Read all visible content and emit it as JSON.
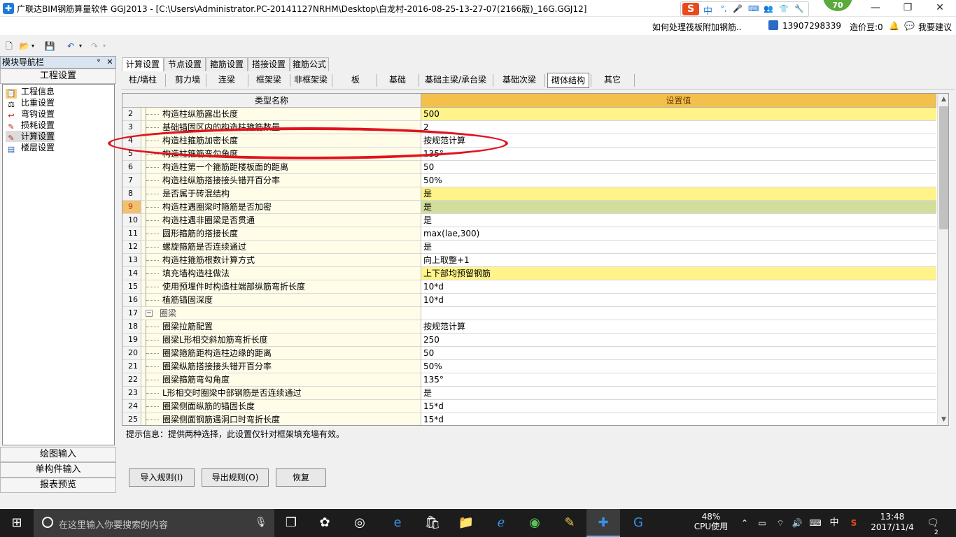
{
  "window": {
    "title": "广联达BIM钢筋算量软件 GGJ2013 - [C:\\Users\\Administrator.PC-20141127NRHM\\Desktop\\白龙村-2016-08-25-13-27-07(2166版)_16G.GGJ12]",
    "minimize": "—",
    "maximize": "❐",
    "close": "✕"
  },
  "ime": {
    "logo": "S",
    "lang": "中",
    "icons": [
      "•,",
      "🎙",
      "⌨",
      "👥",
      "👕",
      "🔧"
    ]
  },
  "score_badge": "70",
  "infobar": {
    "question": "如何处理筏板附加钢筋..",
    "phone": "13907298339",
    "beans": "造价豆:0",
    "suggest": "我要建议"
  },
  "toolbar": {
    "icons": [
      "new-file-icon",
      "open-folder-icon",
      "save-icon",
      "undo-icon",
      "redo-icon"
    ]
  },
  "nav": {
    "title": "模块导航栏",
    "pin": "ᵠ",
    "close": "✕",
    "section": "工程设置",
    "items": [
      {
        "label": "工程信息",
        "icon": "📋"
      },
      {
        "label": "比重设置",
        "icon": "⚖"
      },
      {
        "label": "弯钩设置",
        "icon": "↩"
      },
      {
        "label": "损耗设置",
        "icon": "📉"
      },
      {
        "label": "计算设置",
        "icon": "📝"
      },
      {
        "label": "楼层设置",
        "icon": "🏢"
      }
    ],
    "bottom_sections": [
      "绘图输入",
      "单构件输入",
      "报表预览"
    ]
  },
  "tabs_top": [
    "计算设置",
    "节点设置",
    "箍筋设置",
    "搭接设置",
    "箍筋公式"
  ],
  "tabs_sub": [
    "柱/墙柱",
    "剪力墙",
    "连梁",
    "框架梁",
    "非框架梁",
    "板",
    "基础",
    "基础主梁/承台梁",
    "基础次梁",
    "砌体结构",
    "其它"
  ],
  "grid": {
    "header_name": "类型名称",
    "header_value": "设置值",
    "rows": [
      {
        "num": "2",
        "name": "构造柱纵筋露出长度",
        "value": "500",
        "hl": "yellow"
      },
      {
        "num": "3",
        "name": "基础锚固区内的构造柱箍筋数量",
        "value": "2",
        "hl": ""
      },
      {
        "num": "4",
        "name": "构造柱箍筋加密长度",
        "value": "按规范计算",
        "hl": ""
      },
      {
        "num": "5",
        "name": "构造柱箍筋弯勾角度",
        "value": "135°",
        "hl": ""
      },
      {
        "num": "6",
        "name": "构造柱第一个箍筋距楼板面的距离",
        "value": "50",
        "hl": ""
      },
      {
        "num": "7",
        "name": "构造柱纵筋搭接接头错开百分率",
        "value": "50%",
        "hl": ""
      },
      {
        "num": "8",
        "name": "是否属于砖混结构",
        "value": "是",
        "hl": "yellow"
      },
      {
        "num": "9",
        "name": "构造柱遇圈梁时箍筋是否加密",
        "value": "是",
        "hl": "green"
      },
      {
        "num": "10",
        "name": "构造柱遇非圈梁是否贯通",
        "value": "是",
        "hl": ""
      },
      {
        "num": "11",
        "name": "圆形箍筋的搭接长度",
        "value": "max(lae,300)",
        "hl": ""
      },
      {
        "num": "12",
        "name": "螺旋箍筋是否连续通过",
        "value": "是",
        "hl": ""
      },
      {
        "num": "13",
        "name": "构造柱箍筋根数计算方式",
        "value": "向上取整+1",
        "hl": ""
      },
      {
        "num": "14",
        "name": "填充墙构造柱做法",
        "value": "上下部均预留钢筋",
        "hl": "yellow"
      },
      {
        "num": "15",
        "name": "使用预埋件时构造柱端部纵筋弯折长度",
        "value": "10*d",
        "hl": ""
      },
      {
        "num": "16",
        "name": "植筋锚固深度",
        "value": "10*d",
        "hl": ""
      },
      {
        "num": "17",
        "name": "圈梁",
        "value": "",
        "hl": "",
        "group": true
      },
      {
        "num": "18",
        "name": "圈梁拉筋配置",
        "value": "按规范计算",
        "hl": ""
      },
      {
        "num": "19",
        "name": "圈梁L形相交斜加筋弯折长度",
        "value": "250",
        "hl": ""
      },
      {
        "num": "20",
        "name": "圈梁箍筋距构造柱边缘的距离",
        "value": "50",
        "hl": ""
      },
      {
        "num": "21",
        "name": "圈梁纵筋搭接接头错开百分率",
        "value": "50%",
        "hl": ""
      },
      {
        "num": "22",
        "name": "圈梁箍筋弯勾角度",
        "value": "135°",
        "hl": ""
      },
      {
        "num": "23",
        "name": "L形相交时圈梁中部钢筋是否连续通过",
        "value": "是",
        "hl": ""
      },
      {
        "num": "24",
        "name": "圈梁侧面纵筋的锚固长度",
        "value": "15*d",
        "hl": ""
      },
      {
        "num": "25",
        "name": "圈梁侧面钢筋遇洞口时弯折长度",
        "value": "15*d",
        "hl": ""
      }
    ]
  },
  "hint": "提示信息：提供两种选择，此设置仅针对框架填充墙有效。",
  "buttons": {
    "import": "导入规则(I)",
    "export": "导出规则(O)",
    "restore": "恢复"
  },
  "taskbar": {
    "search_placeholder": "在这里输入你要搜索的内容",
    "cpu_percent": "48%",
    "cpu_label": "CPU使用",
    "ime": "中",
    "time": "13:48",
    "date": "2017/11/4",
    "notify_count": "2"
  }
}
